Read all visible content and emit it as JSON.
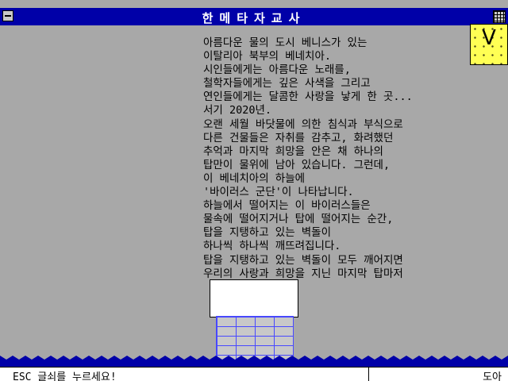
{
  "window": {
    "title": "한메타자교사"
  },
  "clock": {
    "label": "V"
  },
  "story": {
    "lines": [
      "아름다운 물의 도시 베니스가 있는",
      "이탈리아 북부의 베네치아.",
      "시인들에게는 아름다운 노래를,",
      "철학자들에게는 깊은 사색을 그리고",
      "연인들에게는 달콤한 사랑을 낳게 한 곳...",
      "서기 2020년.",
      "오랜 세월 바닷물에 의한 침식과 부식으로",
      "다른 건물들은 자취를 감추고, 화려했던",
      "추억과 마지막 희망을 안은 채 하나의",
      "탑만이 물위에 남아 있습니다. 그런데,",
      "이 베네치아의 하늘에",
      "'바이러스 군단'이 나타납니다.",
      "하늘에서 떨어지는 이 바이러스들은",
      "물속에 떨어지거나 탑에 떨어지는 순간,",
      "탑을 지탱하고 있는 벽돌이",
      "하나씩 하나씩 깨뜨려집니다.",
      "탑을 지탱하고 있는 벽돌이 모두 깨어지면",
      "우리의 사랑과 희망을 지닌 마지막 탑마저"
    ]
  },
  "status": {
    "message": "ESC 글쇠를 누르세요!",
    "help": "도아"
  },
  "colors": {
    "background": "#a8a8a8",
    "titlebar": "#0000a8",
    "water": "#0000a8",
    "brick_line": "#4848ff",
    "clock": "#ffff54"
  }
}
